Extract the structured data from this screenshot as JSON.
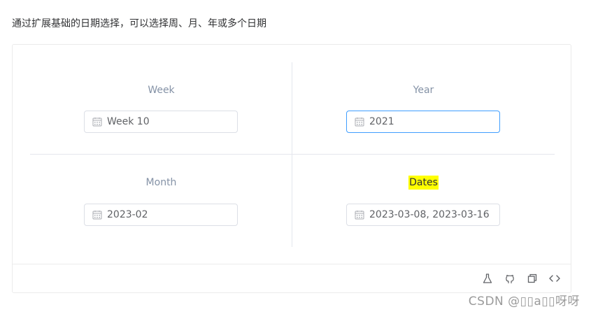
{
  "description": "通过扩展基础的日期选择，可以选择周、月、年或多个日期",
  "pickers": {
    "week": {
      "label": "Week",
      "value": "Week 10"
    },
    "year": {
      "label": "Year",
      "value": "2021"
    },
    "month": {
      "label": "Month",
      "value": "2023-02"
    },
    "dates": {
      "label": "Dates",
      "value": "2023-03-08, 2023-03-16"
    }
  },
  "toolbar": {
    "icons": [
      "flask-icon",
      "github-icon",
      "copy-icon",
      "code-icon"
    ]
  },
  "watermark": "CSDN @▯▯a▯▯呀呀",
  "colors": {
    "focus_border": "#409eff",
    "highlight": "#ffff00",
    "label": "#8492a6",
    "border": "#dcdfe6"
  }
}
